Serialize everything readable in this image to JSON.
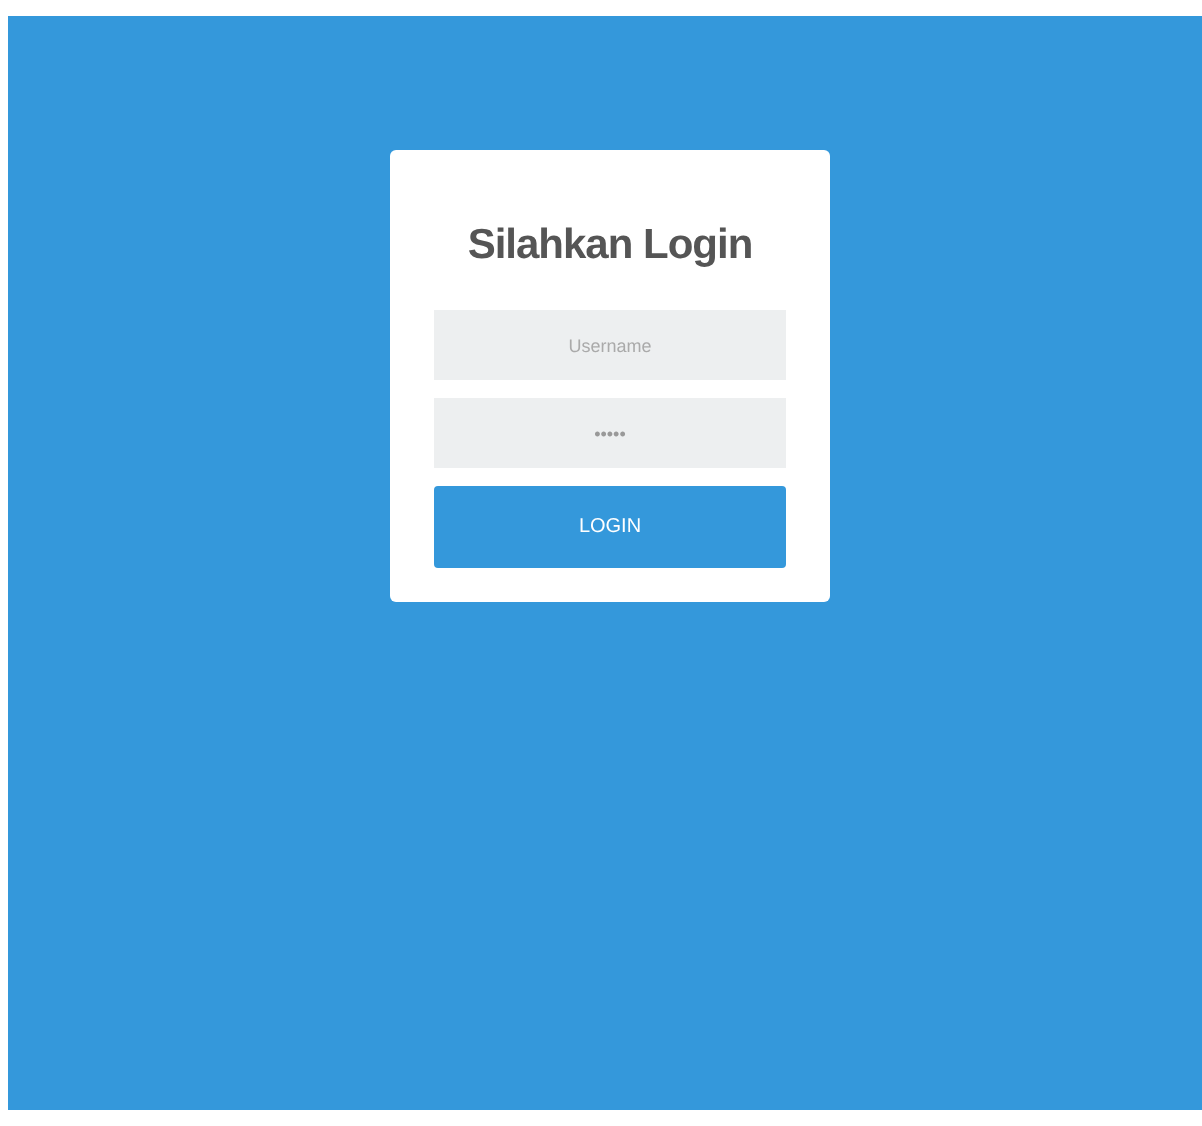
{
  "login_form": {
    "title": "Silahkan Login",
    "username": {
      "placeholder": "Username"
    },
    "password": {
      "value": "•••••"
    },
    "button": "LOGIN"
  }
}
